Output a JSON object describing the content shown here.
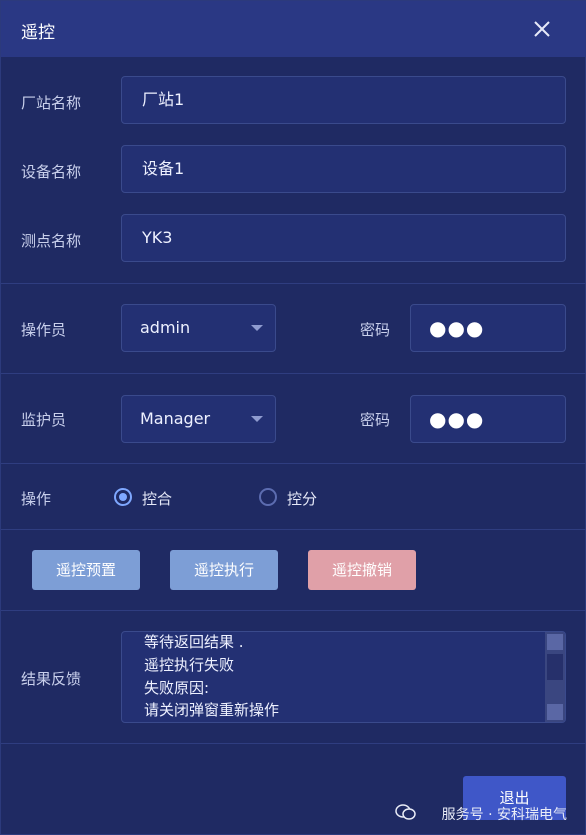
{
  "dialog": {
    "title": "遥控",
    "close_icon": "close-icon"
  },
  "form": {
    "station": {
      "label": "厂站名称",
      "value": "厂站1"
    },
    "device": {
      "label": "设备名称",
      "value": "设备1"
    },
    "point": {
      "label": "测点名称",
      "value": "YK3"
    },
    "operator": {
      "label": "操作员",
      "selected": "admin",
      "password_label": "密码",
      "password_mask": "●●●"
    },
    "supervisor": {
      "label": "监护员",
      "selected": "Manager",
      "password_label": "密码",
      "password_mask": "●●●"
    },
    "operation": {
      "label": "操作",
      "options": [
        {
          "label": "控合",
          "checked": true
        },
        {
          "label": "控分",
          "checked": false
        }
      ]
    }
  },
  "actions": {
    "preset": "遥控预置",
    "execute": "遥控执行",
    "cancel": "遥控撤销"
  },
  "result": {
    "label": "结果反馈",
    "lines": [
      "等待返回结果 .",
      "遥控执行失败",
      "失败原因:",
      "请关闭弹窗重新操作"
    ]
  },
  "footer": {
    "exit": "退出",
    "watermark": "服务号 · 安科瑞电气"
  },
  "colors": {
    "background": "#1f2a63",
    "titlebar": "#2a3884",
    "button_blue": "#7d9ed6",
    "button_red": "#e0a0a8",
    "button_exit": "#3f57c8",
    "radio_accent": "#7fa8ff"
  }
}
